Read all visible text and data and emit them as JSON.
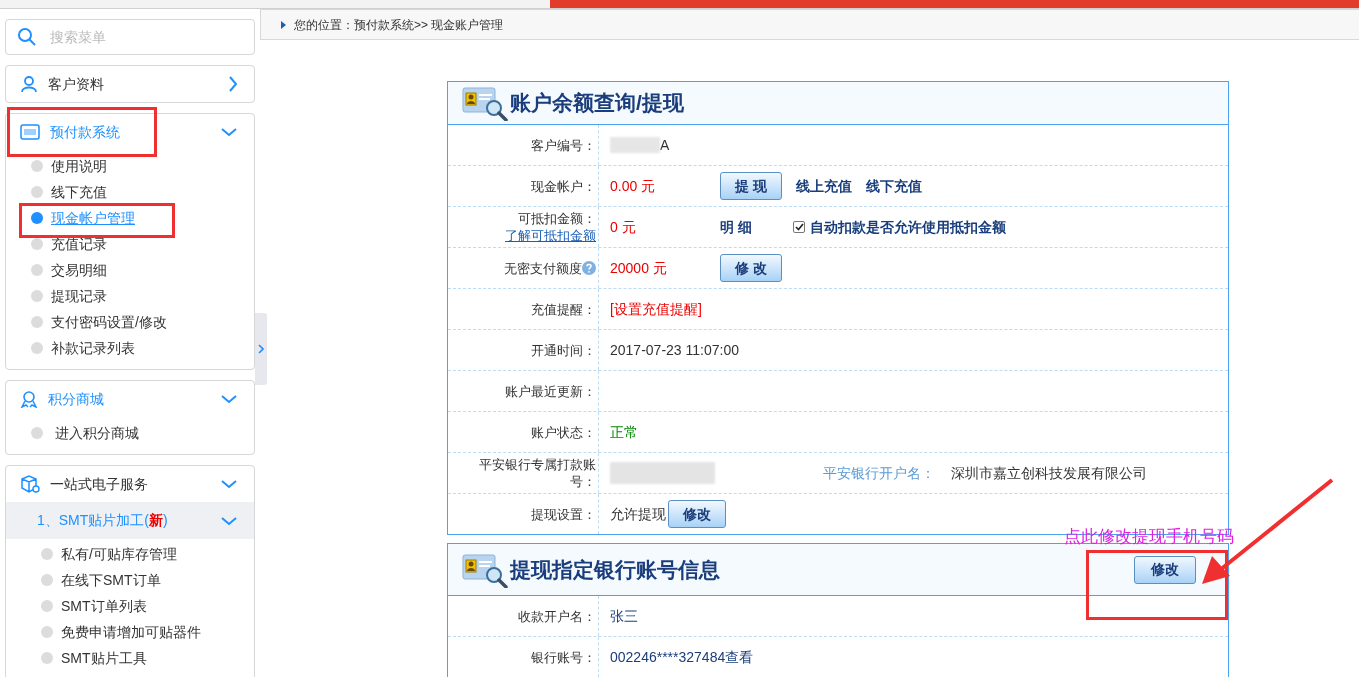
{
  "sidebar": {
    "search": {
      "placeholder": "搜索菜单"
    },
    "groups": [
      {
        "title": "客户资料",
        "active": false,
        "expanded": false
      },
      {
        "title": "预付款系统",
        "active": true,
        "expanded": true,
        "items": [
          {
            "label": "使用说明",
            "selected": false
          },
          {
            "label": "线下充值",
            "selected": false
          },
          {
            "label": "现金帐户管理",
            "selected": true
          },
          {
            "label": "充值记录",
            "selected": false
          },
          {
            "label": "交易明细",
            "selected": false
          },
          {
            "label": "提现记录",
            "selected": false
          },
          {
            "label": "支付密码设置/修改",
            "selected": false
          },
          {
            "label": "补款记录列表",
            "selected": false
          }
        ]
      },
      {
        "title": "积分商城",
        "active": true,
        "expanded": true,
        "items": [
          {
            "label": "进入积分商城",
            "selected": false
          }
        ]
      },
      {
        "title": "一站式电子服务",
        "active": false,
        "expanded": true,
        "subgroup": {
          "title": "1、SMT贴片加工(",
          "badge": "新",
          "suffix": ")",
          "expanded": true,
          "items": [
            {
              "label": "私有/可贴库存管理",
              "selected": false
            },
            {
              "label": "在线下SMT订单",
              "selected": false
            },
            {
              "label": "SMT订单列表",
              "selected": false
            },
            {
              "label": "免费申请增加可贴器件",
              "selected": false
            },
            {
              "label": "SMT贴片工具",
              "selected": false
            }
          ]
        }
      }
    ]
  },
  "breadcrumb": "您的位置：预付款系统>> 现金账户管理",
  "panels": [
    {
      "title": "账户余额查询/提现",
      "rows": [
        {
          "label": "客户编号：",
          "items": [
            {
              "kind": "masked"
            },
            {
              "kind": "value",
              "text": "A"
            }
          ]
        },
        {
          "label": "现金帐户：",
          "items": [
            {
              "kind": "amount",
              "text": "0.00 元"
            },
            {
              "kind": "button",
              "text": "提 现"
            },
            {
              "kind": "link",
              "text": "线上充值"
            },
            {
              "kind": "link",
              "text": "线下充值"
            }
          ]
        },
        {
          "label": "可抵扣金额：",
          "label_link": "了解可抵扣金额",
          "items": [
            {
              "kind": "amount",
              "text": "0 元"
            },
            {
              "kind": "bold",
              "text": "明 细"
            },
            {
              "kind": "checkbox",
              "text": "自动扣款是否允许使用抵扣金额",
              "checked": true
            }
          ]
        },
        {
          "label": "无密支付额度",
          "help": true,
          "items": [
            {
              "kind": "amount",
              "text": "20000 元"
            },
            {
              "kind": "button",
              "text": "修 改"
            }
          ]
        },
        {
          "label": "充值提醒：",
          "items": [
            {
              "kind": "reminder",
              "text": "[设置充值提醒]"
            }
          ]
        },
        {
          "label": "开通时间：",
          "items": [
            {
              "kind": "value",
              "text": "2017-07-23 11:07:00"
            }
          ]
        },
        {
          "label": "账户最近更新：",
          "items": []
        },
        {
          "label": "账户状态：",
          "items": [
            {
              "kind": "status",
              "text": "正常"
            }
          ]
        },
        {
          "label": "平安银行专属打款账号：",
          "items": [
            {
              "kind": "masked_wide"
            },
            {
              "kind": "field_label",
              "text": "平安银行开户名："
            },
            {
              "kind": "value",
              "text": "深圳市嘉立创科技发展有限公司"
            }
          ]
        },
        {
          "label": "提现设置：",
          "items": [
            {
              "kind": "value",
              "text": "允许提现"
            },
            {
              "kind": "button",
              "text": "修改"
            }
          ]
        }
      ]
    },
    {
      "title": "提现指定银行账号信息",
      "header_button": "修改",
      "rows": [
        {
          "label": "收款开户名：",
          "items": [
            {
              "kind": "account",
              "text": "张三"
            }
          ]
        },
        {
          "label": "银行账号：",
          "items": [
            {
              "kind": "account",
              "text": "002246****327484查看"
            }
          ]
        }
      ]
    }
  ],
  "annotation": {
    "note": "点此修改提现手机号码"
  }
}
